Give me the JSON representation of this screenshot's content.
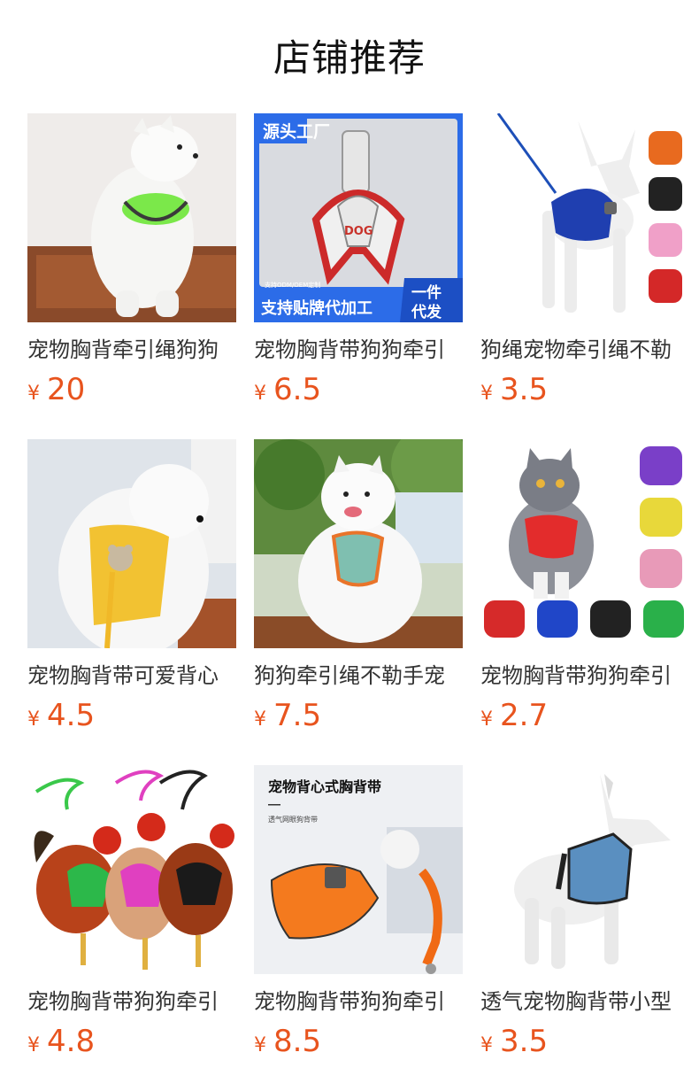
{
  "header": {
    "title": "店铺推荐"
  },
  "currency_symbol": "¥",
  "products": [
    {
      "name": "宠物胸背牵引绳狗狗",
      "price": "20",
      "image": "white-dog-green-harness-image"
    },
    {
      "name": "宠物胸背带狗狗牵引",
      "price": "6.5",
      "image": "factory-harness-ad-image",
      "badge_top": "源头工厂",
      "brand": "DOG",
      "subtext": "支持ODM/OEM定制",
      "bottom_text": "支持贴牌代加工",
      "corner_text": [
        "一件",
        "代发"
      ]
    },
    {
      "name": "狗绳宠物牵引绳不勒",
      "price": "3.5",
      "image": "mannequin-dog-blue-harness-image"
    },
    {
      "name": "宠物胸背带可爱背心",
      "price": "4.5",
      "image": "white-dog-yellow-vest-image"
    },
    {
      "name": "狗狗牵引绳不勒手宠",
      "price": "7.5",
      "image": "samoyed-teal-harness-image"
    },
    {
      "name": "宠物胸背带狗狗牵引",
      "price": "2.7",
      "image": "cat-red-harness-colors-image"
    },
    {
      "name": "宠物胸背带狗狗牵引",
      "price": "4.8",
      "image": "roosters-harness-image"
    },
    {
      "name": "宠物胸背带狗狗牵引",
      "price": "8.5",
      "image": "orange-vest-harness-image",
      "ad_title": "宠物背心式胸背带",
      "ad_sub": "透气网眼狗背带"
    },
    {
      "name": "透气宠物胸背带小型",
      "price": "3.5",
      "image": "mannequin-dog-light-blue-harness-image"
    }
  ]
}
